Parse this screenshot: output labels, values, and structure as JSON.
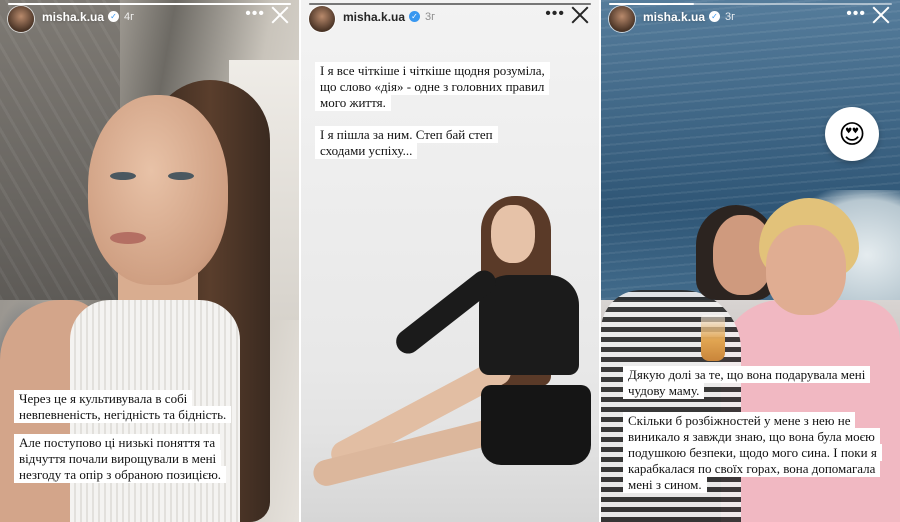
{
  "stories": [
    {
      "username": "misha.k.ua",
      "time": "4г",
      "progress": 1.0,
      "captions": [
        "Через це я культивувала в собі невпевненість, негідність та бідність.",
        "Але поступово ці низькі поняття та відчуття почали вирощували в мені незгоду та опір з обраною позицією."
      ]
    },
    {
      "username": "misha.k.ua",
      "time": "3г",
      "progress": 1.0,
      "captions": [
        "І я все чіткіше і чіткіше щодня розуміла, що слово «дія» - одне з головних правил мого життя.",
        "І я пішла за ним. Степ бай степ сходами успіху..."
      ]
    },
    {
      "username": "misha.k.ua",
      "time": "3г",
      "progress": 0.3,
      "reaction": "😍",
      "captions": [
        "Дякую долі за те, що вона подарувала мені чудову маму.",
        "Скільки б розбіжностей у мене з нею не виникало я завжди знаю, що вона була моєю подушкою безпеки, щодо мого сина. І поки я карабкалася по своїх горах, вона допомагала мені з сином."
      ]
    }
  ],
  "icons": {
    "verified": "verified-badge-icon",
    "more": "more-dots-icon",
    "close": "close-icon"
  },
  "glyphs": {
    "check": "✓",
    "dots": "•••"
  }
}
